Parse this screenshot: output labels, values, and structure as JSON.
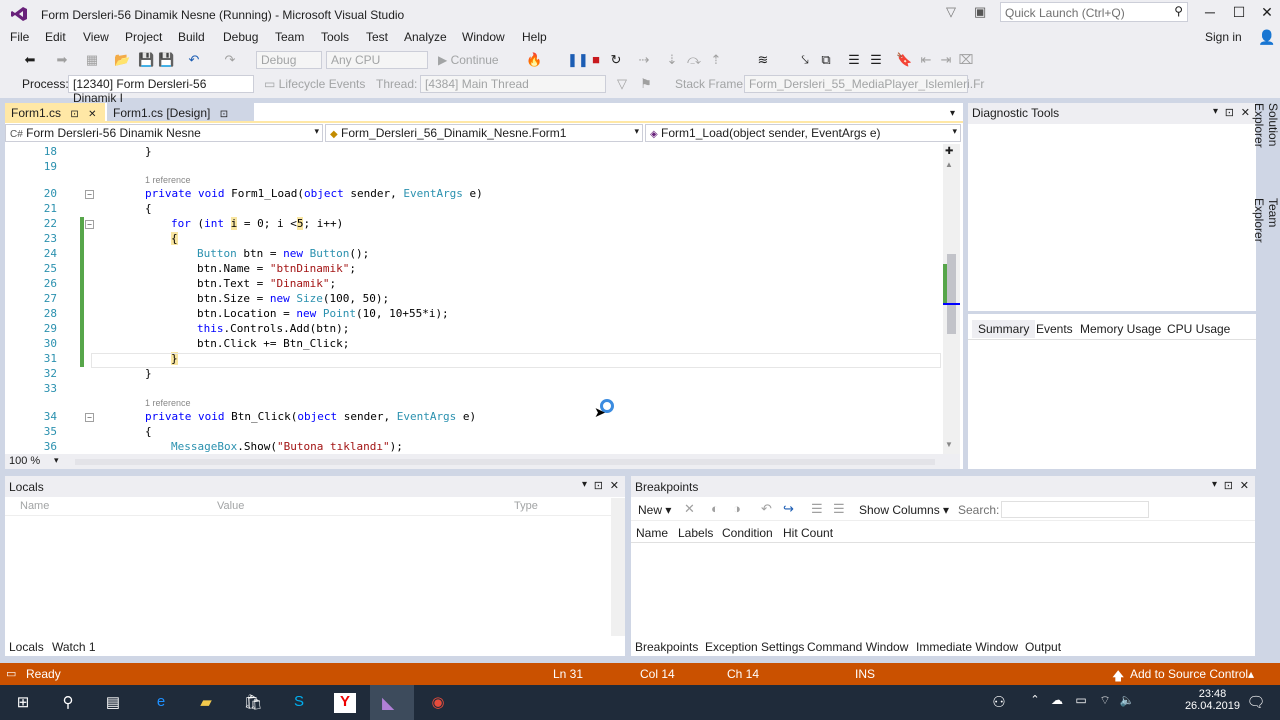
{
  "window": {
    "title": "Form Dersleri-56 Dinamik Nesne (Running) - Microsoft Visual Studio",
    "quick_launch_placeholder": "Quick Launch (Ctrl+Q)",
    "sign_in": "Sign in"
  },
  "menu": [
    "File",
    "Edit",
    "View",
    "Project",
    "Build",
    "Debug",
    "Team",
    "Tools",
    "Test",
    "Analyze",
    "Window",
    "Help"
  ],
  "toolbar": {
    "config": "Debug",
    "platform": "Any CPU",
    "continue": "Continue",
    "process_label": "Process:",
    "process_value": "[12340] Form Dersleri-56 Dinamik I",
    "lifecycle": "Lifecycle Events",
    "thread_label": "Thread:",
    "thread_value": "[4384] Main Thread",
    "stackframe_label": "Stack Frame:",
    "stackframe_value": "Form_Dersleri_55_MediaPlayer_Islemleri.Fr"
  },
  "doc_tabs": {
    "tab1": "Form1.cs",
    "tab2": "Form1.cs [Design]"
  },
  "nav": {
    "project": "Form Dersleri-56 Dinamik Nesne",
    "class": "Form_Dersleri_56_Dinamik_Nesne.Form1",
    "member": "Form1_Load(object sender, EventArgs e)"
  },
  "code_refs": {
    "ref1": "1 reference",
    "ref2": "1 reference"
  },
  "line_numbers": [
    "18",
    "19",
    "20",
    "21",
    "22",
    "23",
    "24",
    "25",
    "26",
    "27",
    "28",
    "29",
    "30",
    "31",
    "32",
    "33",
    "34",
    "35",
    "36"
  ],
  "zoom": "100 %",
  "diagnostic": {
    "title": "Diagnostic Tools",
    "tabs": [
      "Summary",
      "Events",
      "Memory Usage",
      "CPU Usage"
    ]
  },
  "side_tabs": [
    "Solution Explorer",
    "Team Explorer"
  ],
  "locals": {
    "title": "Locals",
    "columns": [
      "Name",
      "Value",
      "Type"
    ],
    "tabs": [
      "Locals",
      "Watch 1"
    ]
  },
  "breakpoints": {
    "title": "Breakpoints",
    "new_label": "New",
    "show_columns": "Show Columns",
    "search_label": "Search:",
    "columns": [
      "Name",
      "Labels",
      "Condition",
      "Hit Count"
    ],
    "tabs": [
      "Breakpoints",
      "Exception Settings",
      "Command Window",
      "Immediate Window",
      "Output"
    ]
  },
  "status": {
    "ready": "Ready",
    "ln": "Ln 31",
    "col": "Col 14",
    "ch": "Ch 14",
    "ins": "INS",
    "source_control": "Add to Source Control"
  },
  "clock": {
    "time": "23:48",
    "date": "26.04.2019"
  },
  "colors": {
    "accent": "#ca5100",
    "tab_active": "#ffe8a6",
    "keyword": "#0000ff",
    "type": "#2b91af",
    "string": "#a31515"
  }
}
